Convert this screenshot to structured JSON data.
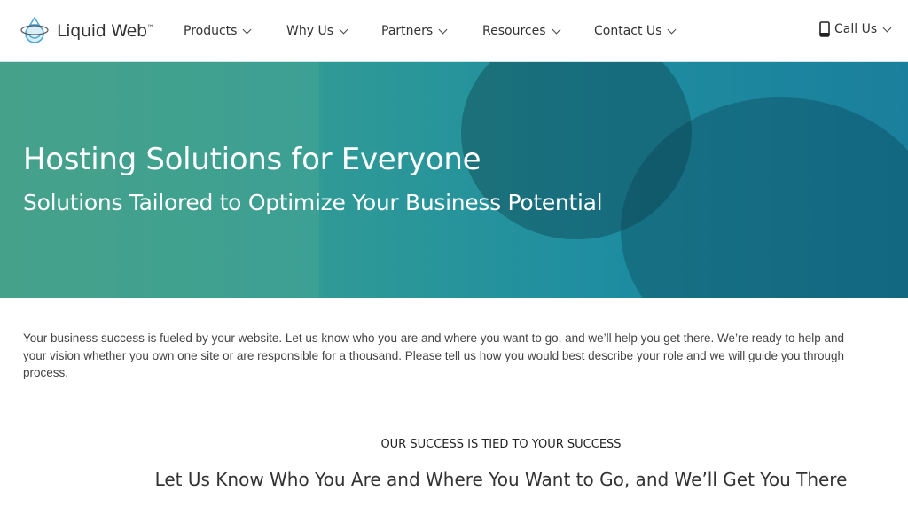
{
  "brand": {
    "name": "Liquid Web",
    "tm": "™"
  },
  "nav": {
    "items": [
      {
        "label": "Products"
      },
      {
        "label": "Why Us"
      },
      {
        "label": "Partners"
      },
      {
        "label": "Resources"
      },
      {
        "label": "Contact Us"
      }
    ],
    "call": "Call Us"
  },
  "hero": {
    "title": "Hosting Solutions for Everyone",
    "subtitle": "Solutions Tailored to Optimize Your Business Potential"
  },
  "intro": {
    "lines": [
      "Your business success is fueled by your website. Let us know who you are and where you want to go, and we’ll help you get there. We’re ready to help and",
      "your vision whether you own one site or are responsible for a thousand. Please tell us how you would best describe your role and we will guide you through",
      "process."
    ]
  },
  "section": {
    "kicker": "OUR SUCCESS IS TIED TO YOUR SUCCESS",
    "heading": "Let Us Know Who You Are and Where You Want to Go, and We’ll Get You There"
  },
  "colors": {
    "accent": "#1f8ea0",
    "logo": "#4aa8d8"
  }
}
